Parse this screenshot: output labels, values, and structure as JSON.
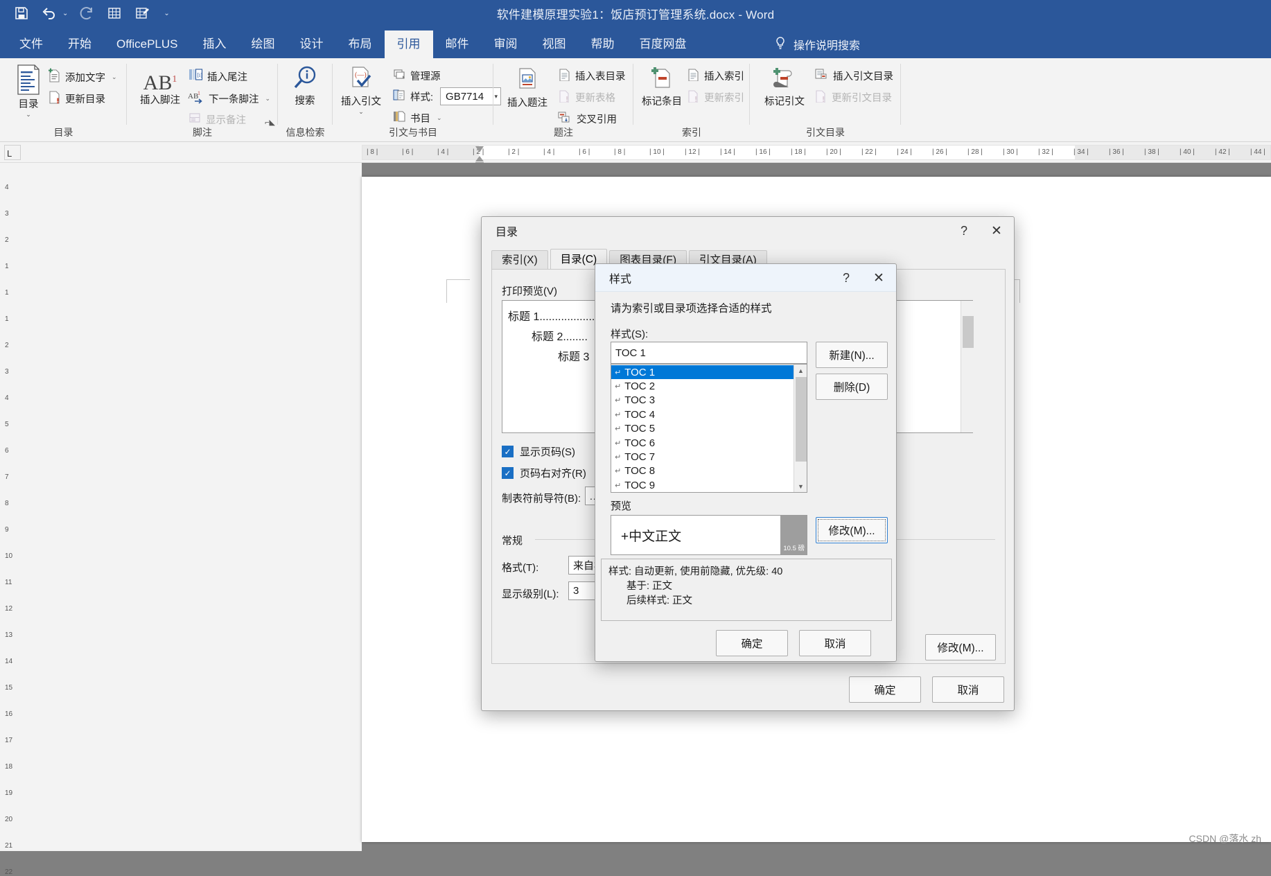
{
  "window": {
    "title": "软件建模原理实验1：饭店预订管理系统.docx  -  Word",
    "accent": "#2b579a"
  },
  "quick_access": [
    {
      "name": "save-icon",
      "label": "保存"
    },
    {
      "name": "undo-icon",
      "label": "撤销"
    },
    {
      "name": "redo-icon",
      "label": "恢复"
    },
    {
      "name": "insert-table-icon",
      "label": "插入表格"
    },
    {
      "name": "edit-doc-icon",
      "label": "编辑"
    },
    {
      "name": "customize-qat-caret-icon",
      "label": "自定义快速访问工具栏"
    }
  ],
  "tabs": [
    {
      "label": "文件",
      "active": false
    },
    {
      "label": "开始",
      "active": false
    },
    {
      "label": "OfficePLUS",
      "active": false
    },
    {
      "label": "插入",
      "active": false
    },
    {
      "label": "绘图",
      "active": false
    },
    {
      "label": "设计",
      "active": false
    },
    {
      "label": "布局",
      "active": false
    },
    {
      "label": "引用",
      "active": true
    },
    {
      "label": "邮件",
      "active": false
    },
    {
      "label": "审阅",
      "active": false
    },
    {
      "label": "视图",
      "active": false
    },
    {
      "label": "帮助",
      "active": false
    },
    {
      "label": "百度网盘",
      "active": false
    }
  ],
  "tell_me": "操作说明搜索",
  "ribbon": {
    "groups": [
      {
        "label": "目录",
        "big": {
          "label": "目录",
          "has_dropdown": true
        },
        "items": [
          {
            "label": "添加文字",
            "disabled": false,
            "caret": true
          },
          {
            "label": "更新目录",
            "disabled": false,
            "caret": false
          }
        ]
      },
      {
        "label": "脚注",
        "big": {
          "label": "插入脚注",
          "has_dropdown": false
        },
        "items": [
          {
            "label": "插入尾注",
            "disabled": false,
            "caret": false
          },
          {
            "label": "下一条脚注",
            "disabled": false,
            "caret": true
          },
          {
            "label": "显示备注",
            "disabled": true,
            "caret": false
          }
        ]
      },
      {
        "label": "信息检索",
        "big": {
          "label": "搜索",
          "has_dropdown": false
        },
        "items": []
      },
      {
        "label": "引文与书目",
        "big": {
          "label": "插入引文",
          "has_dropdown": true
        },
        "items": [
          {
            "label": "管理源",
            "disabled": false,
            "caret": false
          },
          {
            "label": "样式:",
            "disabled": false,
            "caret": false,
            "style_value": "GB7714"
          },
          {
            "label": "书目",
            "disabled": false,
            "caret": true
          }
        ]
      },
      {
        "label": "题注",
        "big": {
          "label": "插入题注",
          "has_dropdown": false
        },
        "items": [
          {
            "label": "插入表目录",
            "disabled": false,
            "caret": false
          },
          {
            "label": "更新表格",
            "disabled": true,
            "caret": false
          },
          {
            "label": "交叉引用",
            "disabled": false,
            "caret": false
          }
        ]
      },
      {
        "label": "索引",
        "big": {
          "label": "标记条目",
          "has_dropdown": false
        },
        "items": [
          {
            "label": "插入索引",
            "disabled": false,
            "caret": false
          },
          {
            "label": "更新索引",
            "disabled": true,
            "caret": false
          }
        ]
      },
      {
        "label": "引文目录",
        "big": {
          "label": "标记引文",
          "has_dropdown": false
        },
        "items": [
          {
            "label": "插入引文目录",
            "disabled": false,
            "caret": false
          },
          {
            "label": "更新引文目录",
            "disabled": true,
            "caret": false
          }
        ]
      }
    ]
  },
  "ruler": {
    "tab_stop_glyph": "L",
    "marks": [
      "8",
      "6",
      "4",
      "2",
      "2",
      "4",
      "6",
      "8",
      "10",
      "12",
      "14",
      "16",
      "18",
      "20",
      "22",
      "24",
      "26",
      "28",
      "30",
      "32",
      "34",
      "36",
      "38",
      "40",
      "42",
      "44"
    ]
  },
  "vruler_marks": [
    "4",
    "3",
    "2",
    "1",
    "1",
    "1",
    "2",
    "3",
    "4",
    "5",
    "6",
    "7",
    "8",
    "9",
    "10",
    "11",
    "12",
    "13",
    "14",
    "15",
    "16",
    "17",
    "18",
    "19",
    "20",
    "21",
    "22"
  ],
  "toc_dialog": {
    "title": "目录",
    "help_glyph": "?",
    "close_glyph": "✕",
    "tabs": [
      {
        "label": "索引(X)",
        "active": false
      },
      {
        "label": "目录(C)",
        "active": true
      },
      {
        "label": "图表目录(F)",
        "active": false
      },
      {
        "label": "引文目录(A)",
        "active": false
      }
    ],
    "print_preview_label": "打印预览(V)",
    "preview_lines": [
      "标题  1..................",
      "标题  2........",
      "标题  3"
    ],
    "checkboxes": [
      {
        "label": "显示页码(S)",
        "checked": true
      },
      {
        "label": "页码右对齐(R)",
        "checked": true
      }
    ],
    "tab_leader_label": "制表符前导符(B):",
    "tab_leader_value": "......",
    "general_label": "常规",
    "format_label": "格式(T):",
    "format_value": "来自模板",
    "levels_label": "显示级别(L):",
    "levels_value": "3",
    "modify_label": "修改(M)...",
    "ok_label": "确定",
    "cancel_label": "取消"
  },
  "style_dialog": {
    "title": "样式",
    "help_glyph": "?",
    "close_glyph": "✕",
    "prompt": "请为索引或目录项选择合适的样式",
    "styles_label": "样式(S):",
    "styles_value": "TOC 1",
    "style_list": [
      "TOC 1",
      "TOC 2",
      "TOC 3",
      "TOC 4",
      "TOC 5",
      "TOC 6",
      "TOC 7",
      "TOC 8",
      "TOC 9"
    ],
    "selected_style": "TOC 1",
    "pilcrow_glyph": "↵",
    "new_label": "新建(N)...",
    "delete_label": "删除(D)",
    "preview_label": "预览",
    "preview_text": "+中文正文",
    "preview_size": "10.5 磅",
    "modify_label": "修改(M)...",
    "description": [
      "样式: 自动更新, 使用前隐藏, 优先级: 40",
      "基于: 正文",
      "后续样式: 正文"
    ],
    "ok_label": "确定",
    "cancel_label": "取消",
    "selection_color": "#0078d7"
  },
  "watermark": "CSDN @落水 zh"
}
